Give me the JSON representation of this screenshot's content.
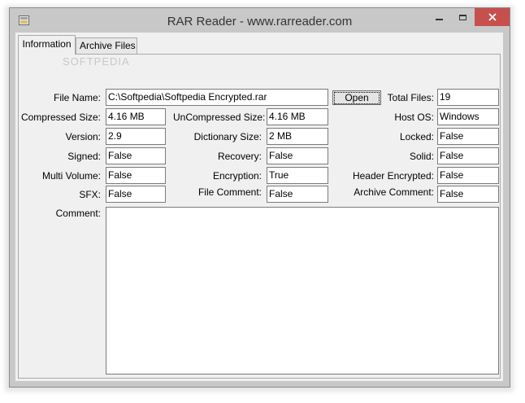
{
  "window": {
    "title": "RAR Reader - www.rarreader.com",
    "icon": "rar-app-icon",
    "controls": {
      "minimize": "minimize-icon",
      "maximize": "maximize-icon",
      "close": "close-icon"
    },
    "close_color": "#c7504c"
  },
  "tabs": [
    {
      "label": "Information",
      "active": true
    },
    {
      "label": "Archive Files",
      "active": false
    }
  ],
  "watermark": "SOFTPEDIA",
  "form": {
    "file_name": {
      "label": "File Name:",
      "value": "C:\\Softpedia\\Softpedia Encrypted.rar"
    },
    "open_button": "Open",
    "total_files": {
      "label": "Total Files:",
      "value": "19"
    },
    "compressed_size": {
      "label": "Compressed Size:",
      "value": "4.16 MB"
    },
    "uncompressed_size": {
      "label": "UnCompressed Size:",
      "value": "4.16 MB"
    },
    "host_os": {
      "label": "Host OS:",
      "value": "Windows"
    },
    "version": {
      "label": "Version:",
      "value": "2.9"
    },
    "dictionary_size": {
      "label": "Dictionary Size:",
      "value": "2 MB"
    },
    "locked": {
      "label": "Locked:",
      "value": "False"
    },
    "signed": {
      "label": "Signed:",
      "value": "False"
    },
    "recovery": {
      "label": "Recovery:",
      "value": "False"
    },
    "solid": {
      "label": "Solid:",
      "value": "False"
    },
    "multi_volume": {
      "label": "Multi Volume:",
      "value": "False"
    },
    "encryption": {
      "label": "Encryption:",
      "value": "True"
    },
    "header_encrypted": {
      "label": "Header Encrypted:",
      "value": "False"
    },
    "sfx": {
      "label": "SFX:",
      "value": "False"
    },
    "file_comment": {
      "label": "File Comment:",
      "value": "False"
    },
    "archive_comment": {
      "label": "Archive Comment:",
      "value": "False"
    },
    "comment": {
      "label": "Comment:",
      "value": ""
    }
  }
}
